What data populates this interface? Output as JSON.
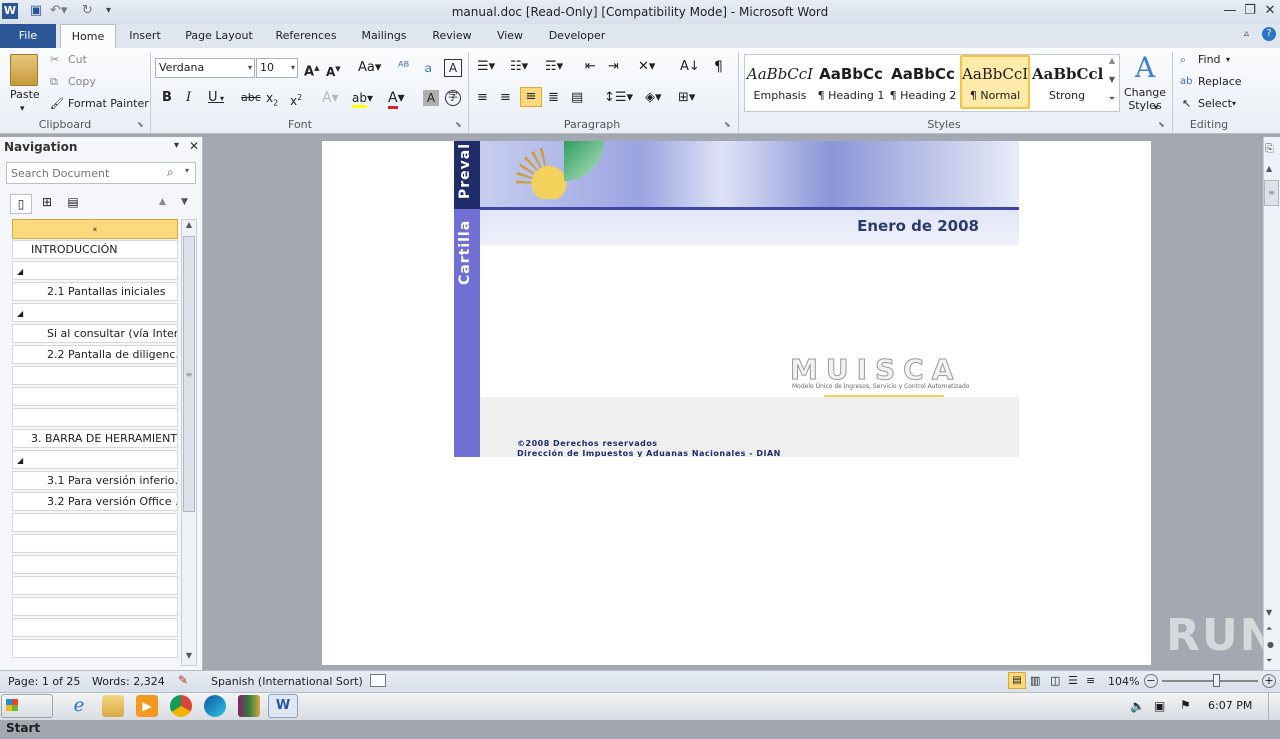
{
  "window": {
    "title": "manual.doc [Read-Only] [Compatibility Mode] - Microsoft Word",
    "quick_access": [
      "save",
      "undo",
      "redo",
      "customize"
    ]
  },
  "tabs": [
    "File",
    "Home",
    "Insert",
    "Page Layout",
    "References",
    "Mailings",
    "Review",
    "View",
    "Developer"
  ],
  "active_tab": "Home",
  "ribbon": {
    "clipboard": {
      "label": "Clipboard",
      "paste": "Paste",
      "cut": "Cut",
      "copy": "Copy",
      "format_painter": "Format Painter"
    },
    "font": {
      "label": "Font",
      "font_name": "Verdana",
      "font_size": "10"
    },
    "paragraph": {
      "label": "Paragraph"
    },
    "styles": {
      "label": "Styles",
      "items": [
        {
          "sample": "AaBbCcI",
          "name": "Emphasis"
        },
        {
          "sample": "AaBbCc",
          "name": "¶ Heading 1"
        },
        {
          "sample": "AaBbCc",
          "name": "¶ Heading 2"
        },
        {
          "sample": "AaBbCcI",
          "name": "¶ Normal"
        },
        {
          "sample": "AaBbCcl",
          "name": "Strong"
        }
      ],
      "selected": "¶ Normal",
      "change_styles": "Change Styles"
    },
    "editing": {
      "label": "Editing",
      "find": "Find",
      "replace": "Replace",
      "select": "Select"
    }
  },
  "navigation": {
    "title": "Navigation",
    "search_placeholder": "Search Document",
    "items": [
      {
        "text": "",
        "level": 0,
        "kind": "collapse-header"
      },
      {
        "text": "INTRODUCCIÓN",
        "level": 1
      },
      {
        "text": "",
        "level": 0,
        "kind": "expander"
      },
      {
        "text": "2.1 Pantallas iniciales",
        "level": 2
      },
      {
        "text": "",
        "level": 0,
        "kind": "expander"
      },
      {
        "text": "Si al consultar (vía Inter…",
        "level": 2
      },
      {
        "text": "2.2 Pantalla de diligenc…",
        "level": 2
      },
      {
        "text": "",
        "level": 1
      },
      {
        "text": "",
        "level": 1
      },
      {
        "text": "",
        "level": 1
      },
      {
        "text": "3. BARRA DE HERRAMIENT…",
        "level": 1
      },
      {
        "text": "",
        "level": 0,
        "kind": "expander"
      },
      {
        "text": "3.1 Para versión inferio…",
        "level": 2
      },
      {
        "text": "3.2 Para versión Office …",
        "level": 2
      },
      {
        "text": "",
        "level": 1
      },
      {
        "text": "",
        "level": 1
      },
      {
        "text": "",
        "level": 1
      },
      {
        "text": "",
        "level": 1
      },
      {
        "text": "",
        "level": 1
      },
      {
        "text": "",
        "level": 1
      }
    ]
  },
  "document": {
    "side_text_top": "Preval",
    "side_text_bottom": "Cartilla",
    "date": "Enero de 2008",
    "logo_text": "MUISCA",
    "logo_subtitle": "Modelo Único de Ingresos, Servicio y Control Automatizado",
    "footer_line1": "©2008 Derechos reservados",
    "footer_line2": "Dirección de Impuestos y Aduanas Nacionales - DIAN"
  },
  "status": {
    "page": "Page: 1 of 25",
    "words": "Words: 2,324",
    "language": "Spanish (International Sort)",
    "zoom": "104%",
    "zoom_fraction": 0.56
  },
  "taskbar": {
    "start": "Start",
    "clock": "6:07 PM"
  },
  "watermark": "ANY RUN",
  "colors": {
    "file_tab": "#2b5797",
    "doc_band": "#8592d8",
    "doc_side": "#6f6fd6",
    "selected_style": "#f5c242"
  }
}
